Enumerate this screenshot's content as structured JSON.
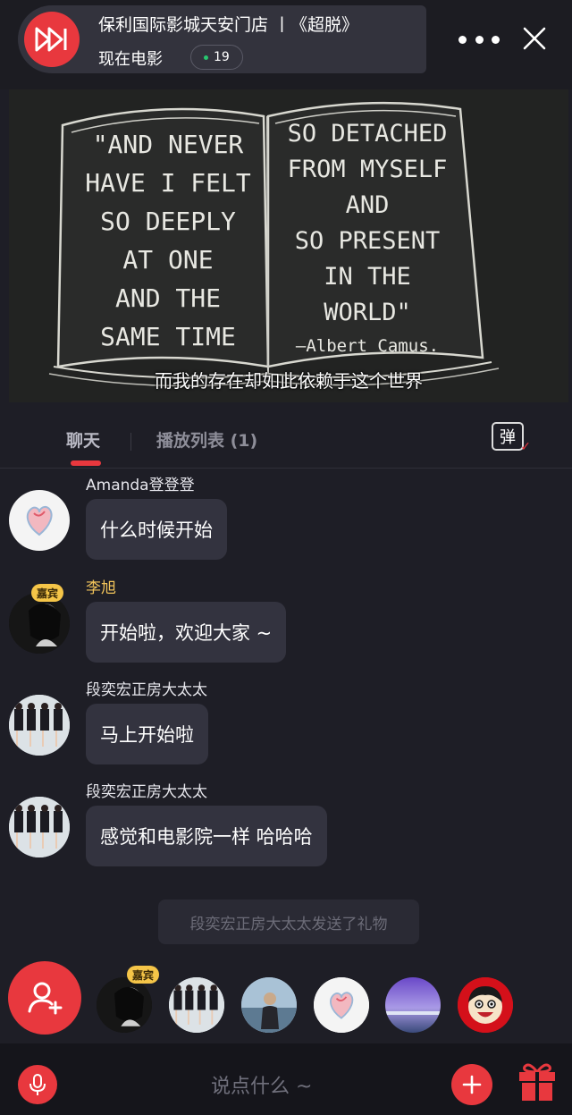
{
  "header": {
    "room_title": "保利国际影城天安门店 丨《超脱》",
    "room_subtitle": "现在电影",
    "viewer_count": "19",
    "brand_color": "#e8383e"
  },
  "video": {
    "subtitle": "而我的存在却如此依赖于这个世界",
    "chalk_left": [
      "\"AND NEVER",
      "HAVE I FELT",
      "SO DEEPLY",
      "AT ONE",
      "AND THE",
      "SAME TIME"
    ],
    "chalk_right": [
      "SO DETACHED",
      "FROM MYSELF",
      "AND",
      "SO PRESENT",
      "IN THE",
      "WORLD\"",
      "—Albert Camus."
    ]
  },
  "tabs": {
    "chat": "聊天",
    "playlist": "播放列表 (1)",
    "danmaku": "弹"
  },
  "chat": {
    "messages": [
      {
        "sender": "Amanda登登登",
        "text": "什么时候开始",
        "guest": false
      },
      {
        "sender": "李旭",
        "text": "开始啦，欢迎大家 ~",
        "guest": true
      },
      {
        "sender": "段奕宏正房大太太",
        "text": "马上开始啦",
        "guest": false
      },
      {
        "sender": "段奕宏正房大太太",
        "text": "感觉和电影院一样 哈哈哈",
        "guest": false
      }
    ],
    "guest_badge": "嘉宾",
    "system_message": "段奕宏正房大太太发送了礼物"
  },
  "audience": {
    "guest_badge": "嘉宾"
  },
  "bottom": {
    "input_placeholder": "说点什么 ~"
  }
}
